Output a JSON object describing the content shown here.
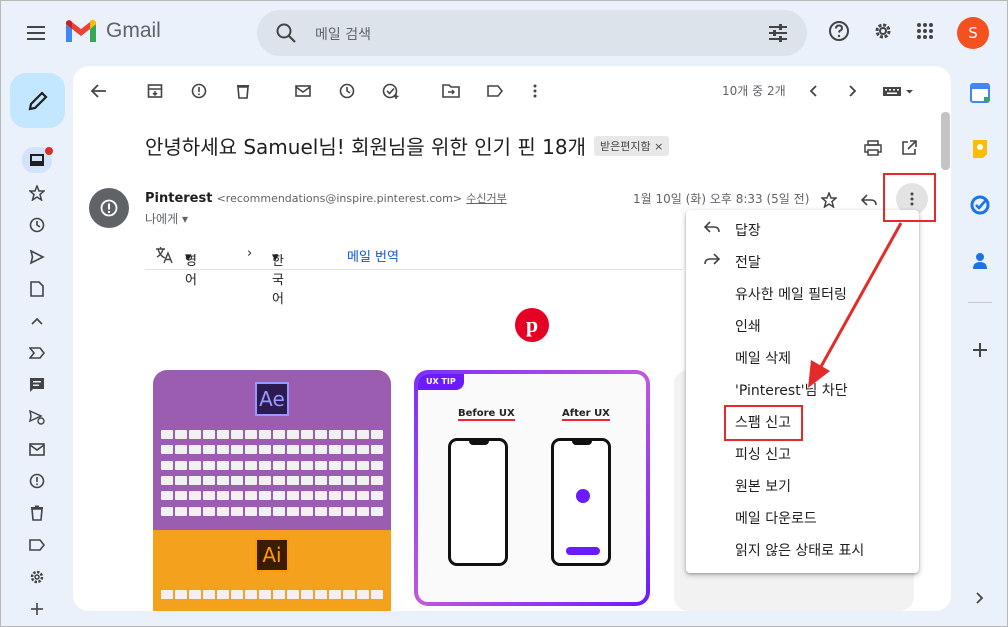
{
  "app": {
    "logo_text": "Gmail"
  },
  "search": {
    "placeholder": "메일 검색"
  },
  "avatar": {
    "initial": "S"
  },
  "toolbar": {
    "count": "10개 중 2개"
  },
  "email": {
    "subject": "안녕하세요 Samuel님! 회원님을 위한 인기 핀 18개",
    "tag": "받은편지함",
    "sender_name": "Pinterest",
    "sender_email": "<recommendations@inspire.pinterest.com>",
    "unsubscribe": "수신거부",
    "to_me": "나에게",
    "date": "1월 10일 (화) 오후 8:33 (5일 전)"
  },
  "translate": {
    "from": "영어",
    "to": "한국어",
    "action": "메일 번역"
  },
  "cards": {
    "ux_tag": "UX TIP",
    "before": "Before UX",
    "after": "After UX",
    "ae": "Ae",
    "ai": "Ai"
  },
  "menu": {
    "items": [
      {
        "label": "답장",
        "icon": "reply-icon"
      },
      {
        "label": "전달",
        "icon": "forward-icon"
      },
      {
        "label": "유사한 메일 필터링"
      },
      {
        "label": "인쇄"
      },
      {
        "label": "메일 삭제"
      },
      {
        "label": "'Pinterest'님 차단"
      },
      {
        "label": "스팸 신고"
      },
      {
        "label": "피싱 신고"
      },
      {
        "label": "원본 보기"
      },
      {
        "label": "메일 다운로드"
      },
      {
        "label": "읽지 않은 상태로 표시"
      }
    ]
  },
  "colors": {
    "highlight": "#e52a2a",
    "accent": "#c2e7ff",
    "pinterest": "#e60023"
  }
}
